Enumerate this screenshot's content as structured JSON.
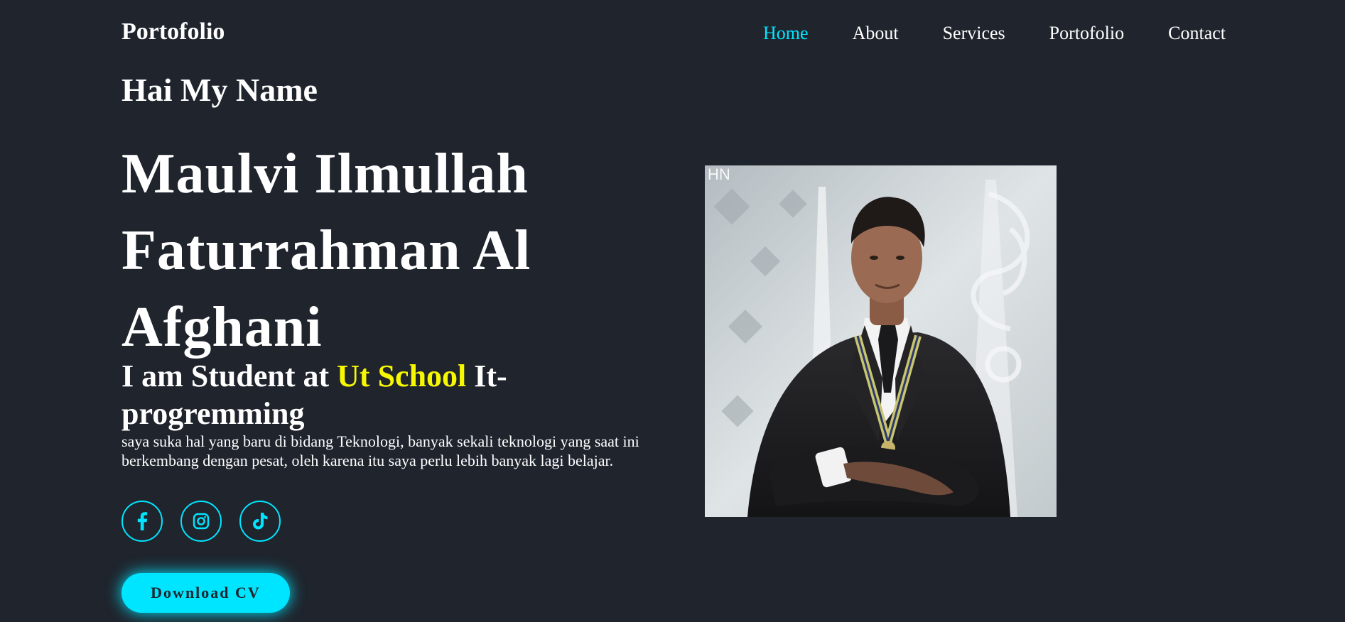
{
  "header": {
    "logo": "Portofolio",
    "nav": [
      {
        "label": "Home",
        "active": true
      },
      {
        "label": "About",
        "active": false
      },
      {
        "label": "Services",
        "active": false
      },
      {
        "label": "Portofolio",
        "active": false
      },
      {
        "label": "Contact",
        "active": false
      }
    ]
  },
  "hero": {
    "greeting": "Hai My Name",
    "name": "Maulvi Ilmullah Faturrahman Al Afghani",
    "role_prefix": "I am Student at",
    "role_highlight": "Ut School",
    "role_suffix": "It-progremming",
    "description": "saya suka hal yang baru di bidang Teknologi, banyak sekali teknologi yang saat ini berkembang dengan pesat, oleh karena itu saya perlu lebih banyak lagi belajar.",
    "socials": [
      {
        "icon": "facebook-icon"
      },
      {
        "icon": "instagram-icon"
      },
      {
        "icon": "tiktok-icon"
      }
    ],
    "cv_button": "Download CV",
    "photo_corner_text": "HN"
  },
  "colors": {
    "background": "#1f242d",
    "accent": "#00e5ff",
    "highlight": "#f6f700",
    "text": "#ffffff"
  }
}
